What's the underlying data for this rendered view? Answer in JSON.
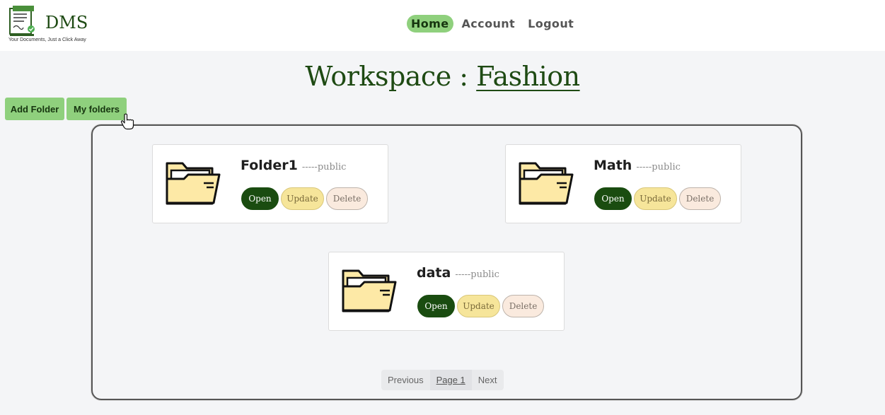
{
  "header": {
    "logo_text": "DMS",
    "logo_tagline": "Your Documents, Just a Click Away",
    "nav": [
      {
        "label": "Home",
        "active": true
      },
      {
        "label": "Account",
        "active": false
      },
      {
        "label": "Logout",
        "active": false
      }
    ]
  },
  "workspace": {
    "prefix": "Workspace : ",
    "name": "Fashion"
  },
  "actions": {
    "add_folder": "Add Folder",
    "my_folders": "My folders"
  },
  "folders": [
    {
      "name": "Folder1",
      "visibility": "-----public"
    },
    {
      "name": "Math",
      "visibility": "-----public"
    },
    {
      "name": "data",
      "visibility": "-----public"
    }
  ],
  "folder_buttons": {
    "open": "Open",
    "update": "Update",
    "delete": "Delete"
  },
  "pagination": {
    "previous": "Previous",
    "current": "Page 1",
    "next": "Next"
  },
  "colors": {
    "accent_green": "#8fd07d",
    "dark_green": "#1a4c10",
    "update_yellow": "#f6e59a",
    "delete_beige": "#faeade",
    "folder_fill": "#fde9a6"
  }
}
